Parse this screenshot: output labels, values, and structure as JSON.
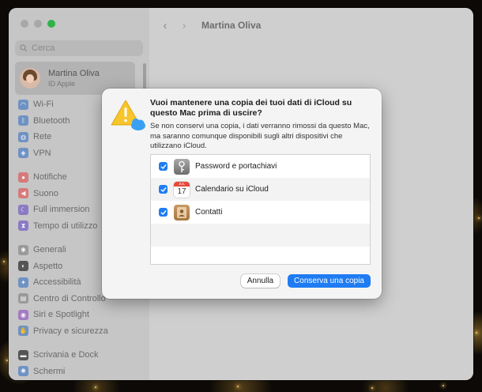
{
  "window": {
    "sidebar": {
      "search_placeholder": "Cerca",
      "account": {
        "name": "Martina Oliva",
        "subtitle": "ID Apple"
      },
      "groups": [
        [
          {
            "label": "Wi-Fi",
            "icon": "wifi-icon",
            "color": "#6f92c4"
          },
          {
            "label": "Bluetooth",
            "icon": "bluetooth-icon",
            "color": "#6f92c4"
          },
          {
            "label": "Rete",
            "icon": "network-icon",
            "color": "#6f92c4"
          },
          {
            "label": "VPN",
            "icon": "vpn-icon",
            "color": "#6f92c4"
          }
        ],
        [
          {
            "label": "Notifiche",
            "icon": "bell-icon",
            "color": "#d67a7a"
          },
          {
            "label": "Suono",
            "icon": "speaker-icon",
            "color": "#d67a7a"
          },
          {
            "label": "Full immersion",
            "icon": "moon-icon",
            "color": "#8a7ac4"
          },
          {
            "label": "Tempo di utilizzo",
            "icon": "hourglass-icon",
            "color": "#8a7ac4"
          }
        ],
        [
          {
            "label": "Generali",
            "icon": "gear-icon",
            "color": "#9a9a9a"
          },
          {
            "label": "Aspetto",
            "icon": "appearance-icon",
            "color": "#555555"
          },
          {
            "label": "Accessibilità",
            "icon": "accessibility-icon",
            "color": "#6f92c4"
          },
          {
            "label": "Centro di Controllo",
            "icon": "control-center-icon",
            "color": "#9a9a9a"
          },
          {
            "label": "Siri e Spotlight",
            "icon": "siri-icon",
            "color": "#a37ac4"
          },
          {
            "label": "Privacy e sicurezza",
            "icon": "hand-icon",
            "color": "#6f92c4"
          }
        ],
        [
          {
            "label": "Scrivania e Dock",
            "icon": "dock-icon",
            "color": "#555555"
          },
          {
            "label": "Schermi",
            "icon": "display-icon",
            "color": "#6f92c4"
          }
        ]
      ]
    },
    "content": {
      "title": "Martina Oliva"
    }
  },
  "dialog": {
    "title": "Vuoi mantenere una copia dei tuoi dati di iCloud su questo Mac prima di uscire?",
    "body": "Se non conservi una copia, i dati verranno rimossi da questo Mac, ma saranno comunque disponibili sugli altri dispositivi che utilizzano iCloud.",
    "items": [
      {
        "label": "Password e portachiavi",
        "checked": true,
        "icon": "keychain-icon"
      },
      {
        "label": "Calendario su iCloud",
        "checked": true,
        "icon": "calendar-icon",
        "icon_text": {
          "month": "JUL",
          "day": "17"
        }
      },
      {
        "label": "Contatti",
        "checked": true,
        "icon": "contacts-icon"
      }
    ],
    "buttons": {
      "cancel": "Annulla",
      "confirm": "Conserva una copia"
    }
  }
}
